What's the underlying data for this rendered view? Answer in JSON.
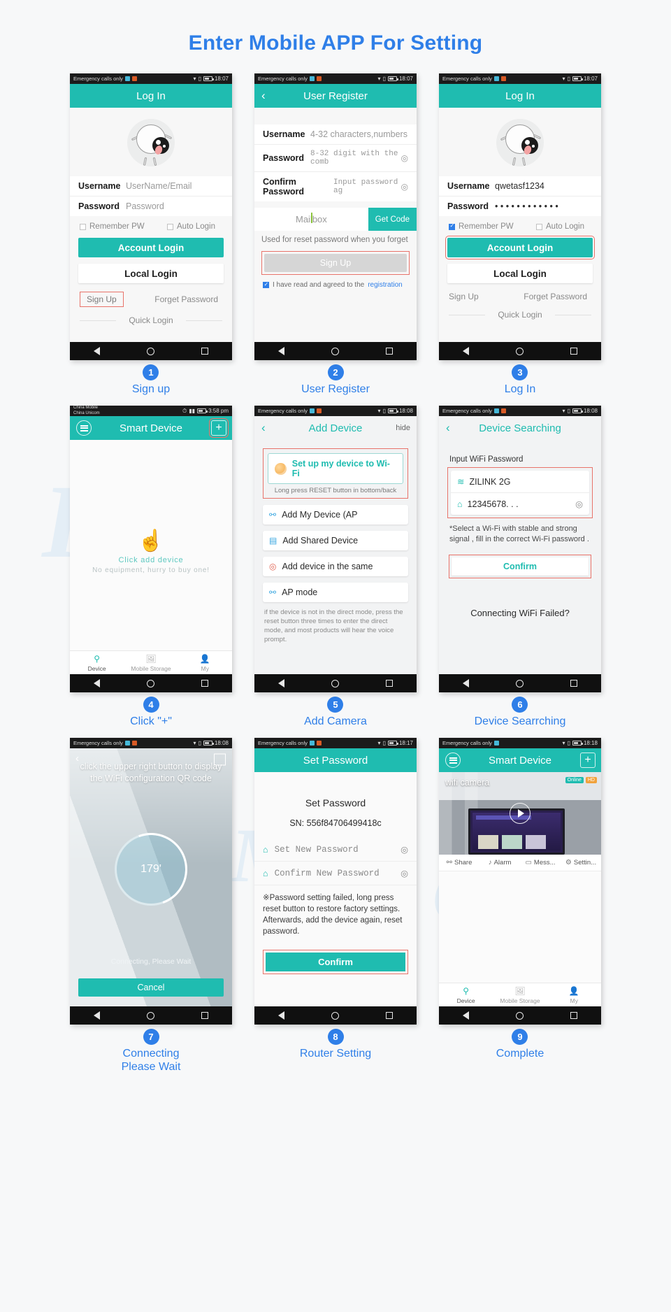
{
  "page": {
    "title": "Enter Mobile APP For Setting"
  },
  "watermark": {
    "w1": "Hi",
    "w2": "Hi",
    "w3": "S",
    "w4": "o",
    "w5": "M"
  },
  "nav": {
    "back_icon": "triangle-back-icon",
    "home_icon": "circle-home-icon",
    "recent_icon": "square-recent-icon"
  },
  "panels": [
    {
      "id": "signup",
      "status": {
        "carrier": "Emergency calls only",
        "time": "18:07"
      },
      "title": "Log In",
      "fields": [
        {
          "label": "Username",
          "value": "UserName/Email"
        },
        {
          "label": "Password",
          "value": "Password"
        }
      ],
      "checks": [
        {
          "label": "Remember PW",
          "checked": false
        },
        {
          "label": "Auto Login",
          "checked": false
        }
      ],
      "primary_button": "Account Login",
      "secondary_button": "Local Login",
      "links": {
        "signup": "Sign Up",
        "forget": "Forget Password",
        "quick": "Quick Login"
      },
      "caption": {
        "num": "1",
        "text": "Sign up"
      }
    },
    {
      "id": "register",
      "status": {
        "carrier": "Emergency calls only",
        "time": "18:07"
      },
      "title": "User Register",
      "fields": [
        {
          "label": "Username",
          "value": "4-32 characters,numbers"
        },
        {
          "label": "Password",
          "value": "8-32 digit with the comb"
        },
        {
          "label": "Confirm Password",
          "value": "Input password ag"
        }
      ],
      "mailbox": {
        "placeholder": "Mailbox",
        "get_code": "Get Code"
      },
      "hint": "Used for reset password when you forget",
      "signup_button": "Sign Up",
      "agree": {
        "text": "I have read and agreed to the",
        "link": "registration",
        "checked": true
      },
      "caption": {
        "num": "2",
        "text": "User Register"
      }
    },
    {
      "id": "login",
      "status": {
        "carrier": "Emergency calls only",
        "time": "18:07"
      },
      "title": "Log In",
      "fields": [
        {
          "label": "Username",
          "value": "qwetasf1234"
        },
        {
          "label": "Password",
          "value": "• • • • • • • • • • • •"
        }
      ],
      "checks": [
        {
          "label": "Remember PW",
          "checked": true
        },
        {
          "label": "Auto Login",
          "checked": false
        }
      ],
      "primary_button": "Account Login",
      "secondary_button": "Local Login",
      "links": {
        "signup": "Sign Up",
        "forget": "Forget Password",
        "quick": "Quick Login"
      },
      "caption": {
        "num": "3",
        "text": "Log In"
      }
    },
    {
      "id": "smart-device",
      "status": {
        "carrier_line1": "China Mobile",
        "carrier_line2": "China Unicom",
        "time": "3:58 pm"
      },
      "title": "Smart Device",
      "plus_icon": "plus-icon",
      "empty": {
        "primary": "Click add device",
        "secondary": "No equipment, hurry to buy one!"
      },
      "tabs": [
        {
          "label": "Device",
          "icon": "location-pin-icon",
          "active": true
        },
        {
          "label": "Mobile Storage",
          "icon": "image-icon",
          "active": false
        },
        {
          "label": "My",
          "icon": "person-icon",
          "active": false
        }
      ],
      "caption": {
        "num": "4",
        "text": "Click \"+\""
      }
    },
    {
      "id": "add-device",
      "status": {
        "carrier": "Emergency calls only",
        "time": "18:08"
      },
      "title": "Add Device",
      "hide_label": "hide",
      "main_option": {
        "label": "Set up my device to Wi-Fi",
        "sub": "Long press RESET button in bottom/back",
        "icon": "moon-icon"
      },
      "options": [
        {
          "label": "Add My Device (AP",
          "icon": "link-add-icon"
        },
        {
          "label": "Add Shared Device",
          "icon": "qr-scan-icon"
        },
        {
          "label": "Add device in the same",
          "icon": "target-icon"
        },
        {
          "label": "AP mode",
          "icon": "link-icon"
        }
      ],
      "note": "if the device is not in the direct mode, press the reset button three times to enter the direct mode, and most products will hear the voice prompt.",
      "caption": {
        "num": "5",
        "text": "Add Camera"
      }
    },
    {
      "id": "device-searching",
      "status": {
        "carrier": "Emergency calls only",
        "time": "18:08"
      },
      "title": "Device Searching",
      "input_label": "Input WiFi Password",
      "wifi": {
        "ssid": "ZILINK 2G",
        "password": "12345678. . .",
        "wifi_icon": "wifi-icon",
        "lock_icon": "lock-icon",
        "eye_icon": "eye-icon"
      },
      "note": "*Select a Wi-Fi with stable and strong signal , fill in the correct Wi-Fi password .",
      "confirm_button": "Confirm",
      "fail_link": "Connecting WiFi Failed?",
      "caption": {
        "num": "6",
        "text": "Device Searrching"
      }
    },
    {
      "id": "connecting",
      "status": {
        "carrier": "Emergency calls only",
        "time": "18:08"
      },
      "instruction": "click the upper right button to display the WiFi configuration QR code",
      "progress": "179'",
      "waiting": "Connecting, Please Wait",
      "cancel_button": "Cancel",
      "qr_icon": "qr-code-icon",
      "back_icon": "chevron-left-icon",
      "caption": {
        "num": "7",
        "text": "Connecting\nPlease Wait"
      },
      "caption_line1": "Connecting",
      "caption_line2": "Please Wait"
    },
    {
      "id": "set-password",
      "status": {
        "carrier": "Emergency calls only",
        "time": "18:17"
      },
      "title": "Set Password",
      "heading": "Set Password",
      "sn": "SN: 556f84706499418c",
      "fields": [
        {
          "label": "Set New Password",
          "icon": "lock-icon",
          "eye": "eye-icon"
        },
        {
          "label": "Confirm New Password",
          "icon": "lock-icon",
          "eye": "eye-icon"
        }
      ],
      "note": "※Password setting failed, long press reset button to restore factory settings. Afterwards, add the device again, reset password.",
      "confirm_button": "Confirm",
      "caption": {
        "num": "8",
        "text": "Router Setting"
      }
    },
    {
      "id": "complete",
      "status": {
        "carrier": "Emergency calls only",
        "time": "18:18"
      },
      "title": "Smart Device",
      "plus_icon": "plus-icon",
      "camera": {
        "name": "wifi camera",
        "badge_online": "Online",
        "badge_hd": "HD",
        "play_icon": "play-icon"
      },
      "actions": [
        {
          "label": "Share",
          "icon": "share-icon"
        },
        {
          "label": "Alarm",
          "icon": "bell-icon"
        },
        {
          "label": "Mess...",
          "icon": "message-icon"
        },
        {
          "label": "Settin...",
          "icon": "gear-icon"
        }
      ],
      "tabs": [
        {
          "label": "Device",
          "icon": "location-pin-icon",
          "active": true
        },
        {
          "label": "Mobile Storage",
          "icon": "image-icon",
          "active": false
        },
        {
          "label": "My",
          "icon": "person-icon",
          "active": false
        }
      ],
      "caption": {
        "num": "9",
        "text": "Complete"
      }
    }
  ]
}
